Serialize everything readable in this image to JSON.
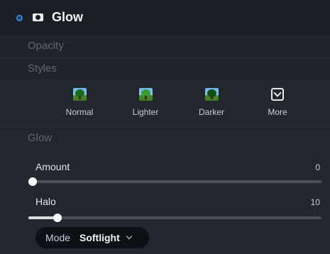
{
  "header": {
    "title": "Glow"
  },
  "sections": {
    "opacity": "Opacity",
    "styles": "Styles",
    "glow": "Glow"
  },
  "styles": [
    {
      "label": "Normal",
      "icon": "tree-thumbnail-icon"
    },
    {
      "label": "Lighter",
      "icon": "tree-thumbnail-icon"
    },
    {
      "label": "Darker",
      "icon": "tree-thumbnail-icon"
    },
    {
      "label": "More",
      "icon": "chevron-down-box-icon"
    }
  ],
  "sliders": {
    "amount": {
      "label": "Amount",
      "value": "0",
      "fraction": 0.0
    },
    "halo": {
      "label": "Halo",
      "value": "10",
      "fraction": 0.1
    }
  },
  "mode": {
    "label": "Mode",
    "value": "Softlight"
  },
  "colors": {
    "accent": "#2b8ff0",
    "panel": "#22272e",
    "header": "#1b2027"
  }
}
